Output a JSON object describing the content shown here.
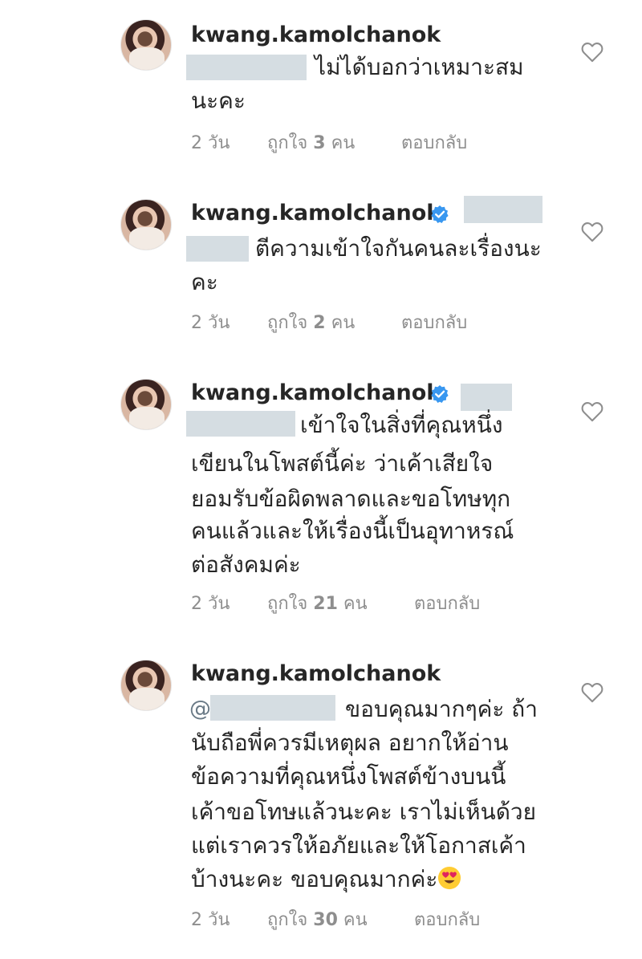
{
  "comments": [
    {
      "username": "kwang.kamolchanok",
      "lines": [
        "ไม่ได้บอกว่าเหมาะสม",
        "นะคะ"
      ],
      "time": "2 วัน",
      "likes_prefix": "ถูกใจ",
      "likes_count": "3",
      "likes_suffix": "คน",
      "reply": "ตอบกลับ"
    },
    {
      "username": "kwang.kamolchanok",
      "lines": [
        "ตีความเข้าใจกันคนละเรื่องนะ",
        "คะ"
      ],
      "time": "2 วัน",
      "likes_prefix": "ถูกใจ",
      "likes_count": "2",
      "likes_suffix": "คน",
      "reply": "ตอบกลับ"
    },
    {
      "username": "kwang.kamolchanok",
      "lines": [
        "เข้าใจในสิ่งที่คุณหนึ่ง",
        "เขียนในโพสต์นี้ค่ะ ว่าเค้าเสียใจ",
        "ยอมรับข้อผิดพลาดและขอโทษทุก",
        "คนแล้วและให้เรื่องนี้เป็นอุทาหรณ์",
        "ต่อสังคมค่ะ"
      ],
      "time": "2 วัน",
      "likes_prefix": "ถูกใจ",
      "likes_count": "21",
      "likes_suffix": "คน",
      "reply": "ตอบกลับ"
    },
    {
      "username": "kwang.kamolchanok",
      "mention_prefix": "@",
      "lines": [
        "ขอบคุณมากๆค่ะ ถ้า",
        "นับถือพี่ควรมีเหตุผล อยากให้อ่าน",
        "ข้อความที่คุณหนึ่งโพสต์ข้างบนนี้",
        "เค้าขอโทษแล้วนะคะ เราไม่เห็นด้วย",
        "แต่เราควรให้อภัยและให้โอกาสเค้า",
        "บ้างนะคะ ขอบคุณมากค่ะ"
      ],
      "emoji": "heart-eyes-emoji",
      "time": "2 วัน",
      "likes_prefix": "ถูกใจ",
      "likes_count": "30",
      "likes_suffix": "คน",
      "reply": "ตอบกลับ"
    }
  ],
  "icons": {
    "like": "heart-outline-icon",
    "verified": "verified-badge-icon"
  },
  "colors": {
    "verified": "#3897f0",
    "meta": "#8e8e8e",
    "mask": "#d5dde2"
  }
}
